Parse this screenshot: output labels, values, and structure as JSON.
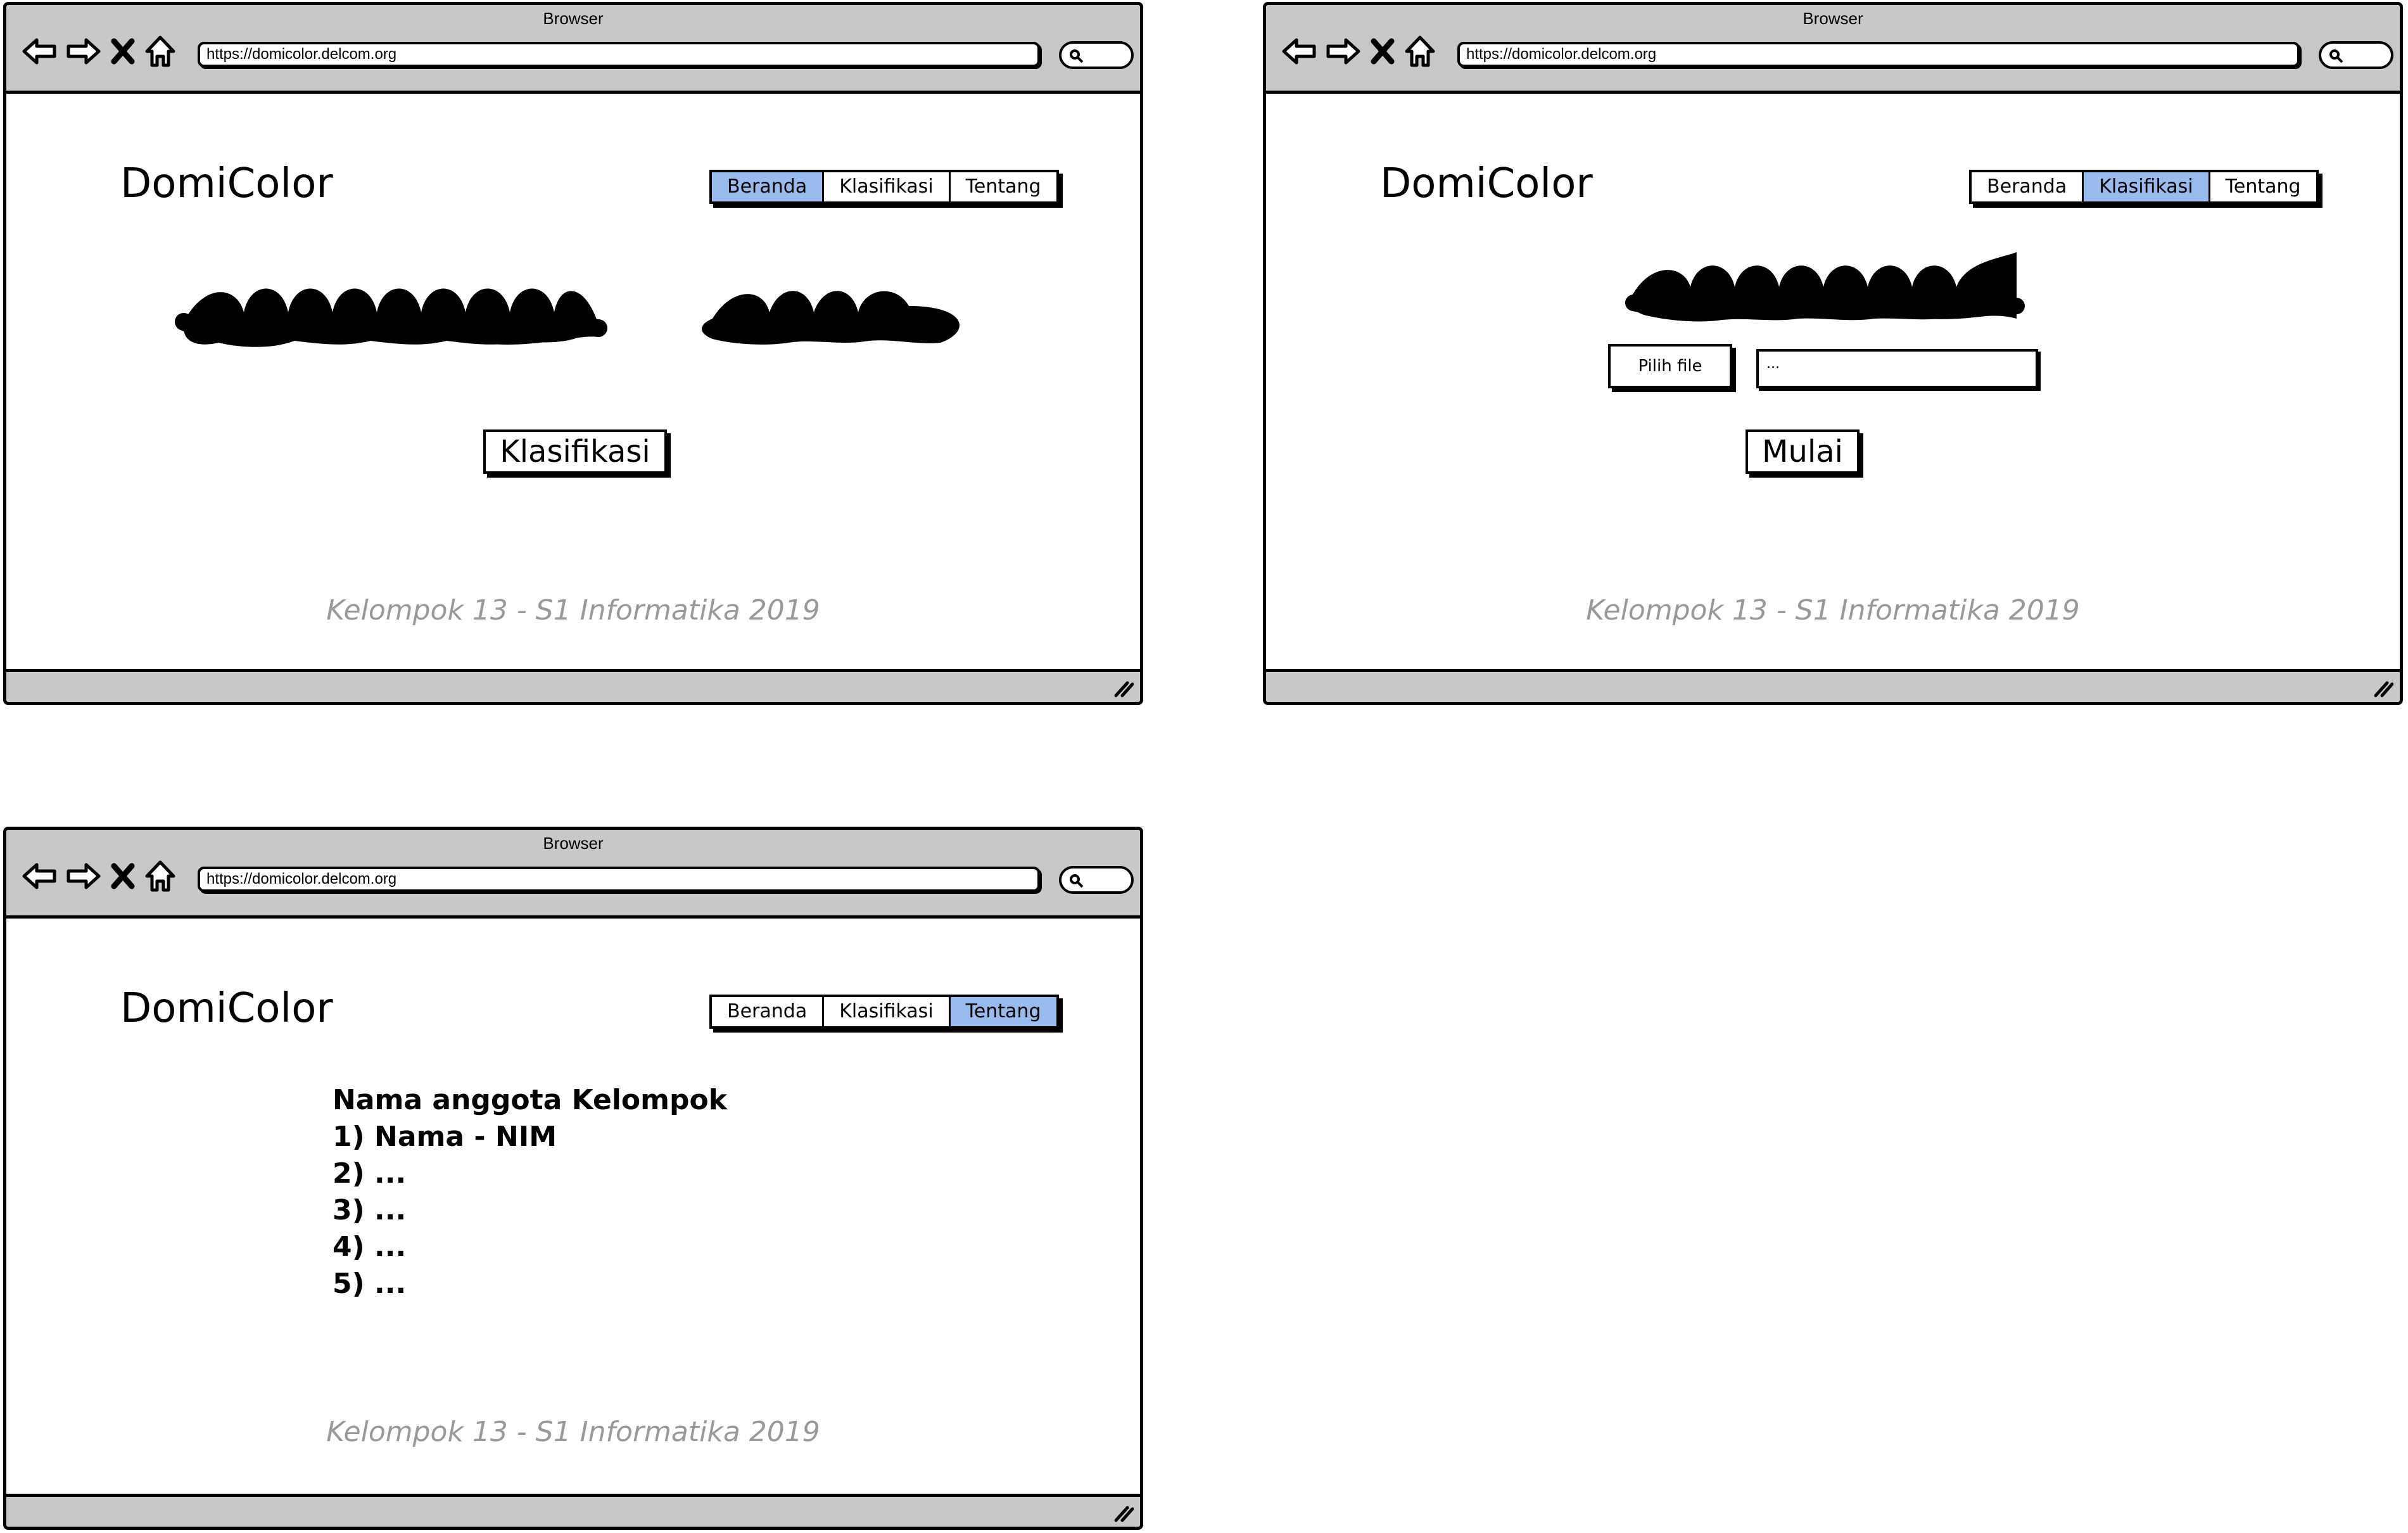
{
  "browser": {
    "title": "Browser",
    "url": "https://domicolor.delcom.org"
  },
  "app": {
    "logo": "DomiColor",
    "tabs": [
      "Beranda",
      "Klasifikasi",
      "Tentang"
    ],
    "footer": "Kelompok 13 - S1 Informatika 2019"
  },
  "beranda": {
    "active_tab": "Beranda",
    "cta_label": "Klasifikasi"
  },
  "klasifikasi": {
    "active_tab": "Klasifikasi",
    "file_button_label": "Pilih file",
    "file_name_value": "...",
    "start_label": "Mulai"
  },
  "tentang": {
    "active_tab": "Tentang",
    "heading": "Nama anggota Kelompok",
    "members": [
      "1) Nama - NIM",
      "2) ...",
      "3) ...",
      "4) ...",
      "5) ..."
    ]
  },
  "colors": {
    "chrome": "#c8c8c8",
    "active_tab": "#99bbee",
    "footer_text": "#999999"
  }
}
